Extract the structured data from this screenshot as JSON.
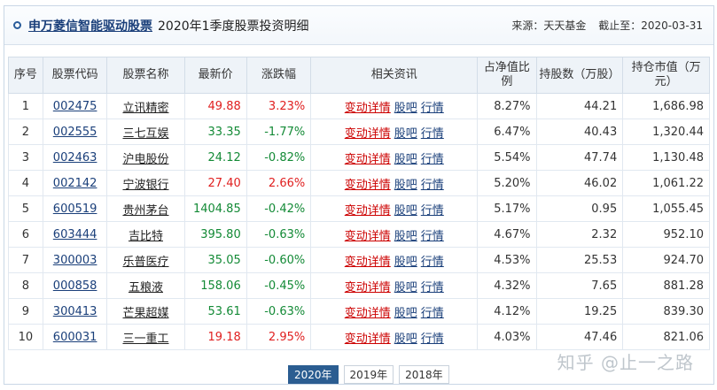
{
  "header": {
    "fund_name": "申万菱信智能驱动股票",
    "title": "2020年1季度股票投资明细",
    "source": "来源：天天基金",
    "cutoff": "截止至：2020-03-31"
  },
  "table": {
    "columns": [
      "序号",
      "股票代码",
      "股票名称",
      "最新价",
      "涨跌幅",
      "相关资讯",
      "占净值比例",
      "持股数（万股）",
      "持仓市值（万元）"
    ],
    "rows": [
      {
        "no": "1",
        "code": "002475",
        "name": "立讯精密",
        "price": "49.88",
        "change": "3.23%",
        "trend": "up",
        "ratio": "8.27%",
        "shares": "44.21",
        "value": "1,686.98"
      },
      {
        "no": "2",
        "code": "002555",
        "name": "三七互娱",
        "price": "33.35",
        "change": "-1.77%",
        "trend": "down",
        "ratio": "6.47%",
        "shares": "40.43",
        "value": "1,320.44"
      },
      {
        "no": "3",
        "code": "002463",
        "name": "沪电股份",
        "price": "24.12",
        "change": "-0.82%",
        "trend": "down",
        "ratio": "5.54%",
        "shares": "47.74",
        "value": "1,130.48"
      },
      {
        "no": "4",
        "code": "002142",
        "name": "宁波银行",
        "price": "27.40",
        "change": "2.66%",
        "trend": "up",
        "ratio": "5.20%",
        "shares": "46.02",
        "value": "1,061.22"
      },
      {
        "no": "5",
        "code": "600519",
        "name": "贵州茅台",
        "price": "1404.85",
        "change": "-0.42%",
        "trend": "down",
        "ratio": "5.17%",
        "shares": "0.95",
        "value": "1,055.45"
      },
      {
        "no": "6",
        "code": "603444",
        "name": "吉比特",
        "price": "395.80",
        "change": "-0.63%",
        "trend": "down",
        "ratio": "4.67%",
        "shares": "2.32",
        "value": "952.10"
      },
      {
        "no": "7",
        "code": "300003",
        "name": "乐普医疗",
        "price": "35.05",
        "change": "-0.60%",
        "trend": "down",
        "ratio": "4.53%",
        "shares": "25.53",
        "value": "924.70"
      },
      {
        "no": "8",
        "code": "000858",
        "name": "五粮液",
        "price": "158.06",
        "change": "-0.45%",
        "trend": "down",
        "ratio": "4.32%",
        "shares": "7.65",
        "value": "881.28"
      },
      {
        "no": "9",
        "code": "300413",
        "name": "芒果超媒",
        "price": "53.61",
        "change": "-0.63%",
        "trend": "down",
        "ratio": "4.12%",
        "shares": "19.25",
        "value": "839.30"
      },
      {
        "no": "10",
        "code": "600031",
        "name": "三一重工",
        "price": "19.18",
        "change": "2.95%",
        "trend": "up",
        "ratio": "4.03%",
        "shares": "47.46",
        "value": "821.06"
      }
    ],
    "info_links": [
      "变动详情",
      "股吧",
      "行情"
    ]
  },
  "years": [
    "2020年",
    "2019年",
    "2018年"
  ],
  "active_year": "2020年",
  "watermark": "知乎 @止一之路",
  "colors": {
    "up": "#e02020",
    "down": "#138a36",
    "link": "#1a3f7a",
    "active_year": "#2b5d91"
  }
}
